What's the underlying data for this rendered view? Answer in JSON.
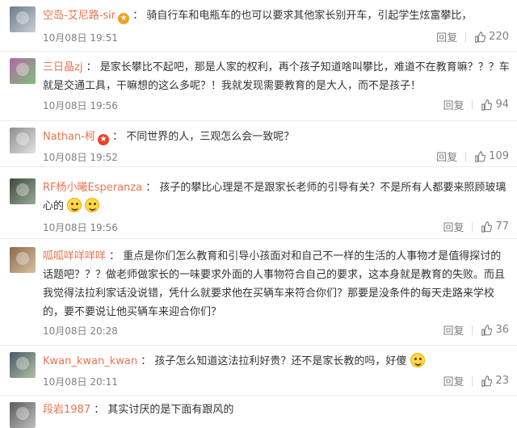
{
  "comments": [
    {
      "username": "空岛-艾尼路-sir",
      "badge": "gold",
      "text": "骑自行车和电瓶车的也可以要求其他家长别开车，引起学生炫富攀比，",
      "time": "10月08日 19:51",
      "reply": "回复",
      "likes": "220",
      "avatar_colors": [
        "#6b7a8c",
        "#c9cfd6"
      ]
    },
    {
      "username": "三日晶zj",
      "text": "是家长攀比不起吧，那是人家的权利，再个孩子知道啥叫攀比，难道不在教育嘛？？？车就是交通工具，干嘛想的这么多呢？！我就发现需要教育的是大人，而不是孩子！",
      "time": "10月08日 19:56",
      "reply": "回复",
      "likes": "94",
      "avatar_colors": [
        "#b06aa0",
        "#7fbf7a"
      ]
    },
    {
      "username": "Nathan-柯",
      "badge": "red",
      "text": "不同世界的人，三观怎么会一致呢？",
      "time": "10月08日 19:52",
      "reply": "回复",
      "likes": "109",
      "avatar_colors": [
        "#8e8e8e",
        "#e2e2e2"
      ]
    },
    {
      "username": "RF杨小曦Esperanza",
      "text": "孩子的攀比心理是不是跟家长老师的引导有关？不是所有人都要来照顾玻璃心的",
      "time": "10月08日 19:56",
      "reply": "回复",
      "likes": "77",
      "avatar_colors": [
        "#3a4a3a",
        "#9aa99a"
      ]
    },
    {
      "username": "呱呱咩咩咩咩",
      "text": "重点是你们怎么教育和引导小孩面对和自己不一样的生活的人事物才是值得探讨的话题吧？？？做老师做家长的一味要求外面的人事物符合自己的要求，这本身就是教育的失败。而且我觉得法拉利家话没说错，凭什么就要求他在买辆车来符合你们？那要是没条件的每天走路来学校的，要不要说让他买辆车来迎合你们？",
      "time": "10月08日 20:28",
      "reply": "回复",
      "likes": "36",
      "avatar_colors": [
        "#8a6a4a",
        "#d8c2a0"
      ]
    },
    {
      "username": "Kwan_kwan_kwan",
      "text": "孩子怎么知道这法拉利好贵？还不是家长教的吗，好傻",
      "time": "10月08日 20:11",
      "reply": "回复",
      "likes": "23",
      "avatar_colors": [
        "#4a5a6a",
        "#b0c0a0"
      ]
    },
    {
      "username": "段岩1987",
      "text": "其实讨厌的是下面有跟风的",
      "avatar_colors": [
        "#5a5a5a",
        "#c0c0c0"
      ]
    }
  ],
  "icons": {
    "like": "thumbs-up-icon",
    "emoji": "smiley-emoji-icon"
  },
  "colors": {
    "username": "#eb7350",
    "meta": "#808080",
    "text": "#333333"
  }
}
